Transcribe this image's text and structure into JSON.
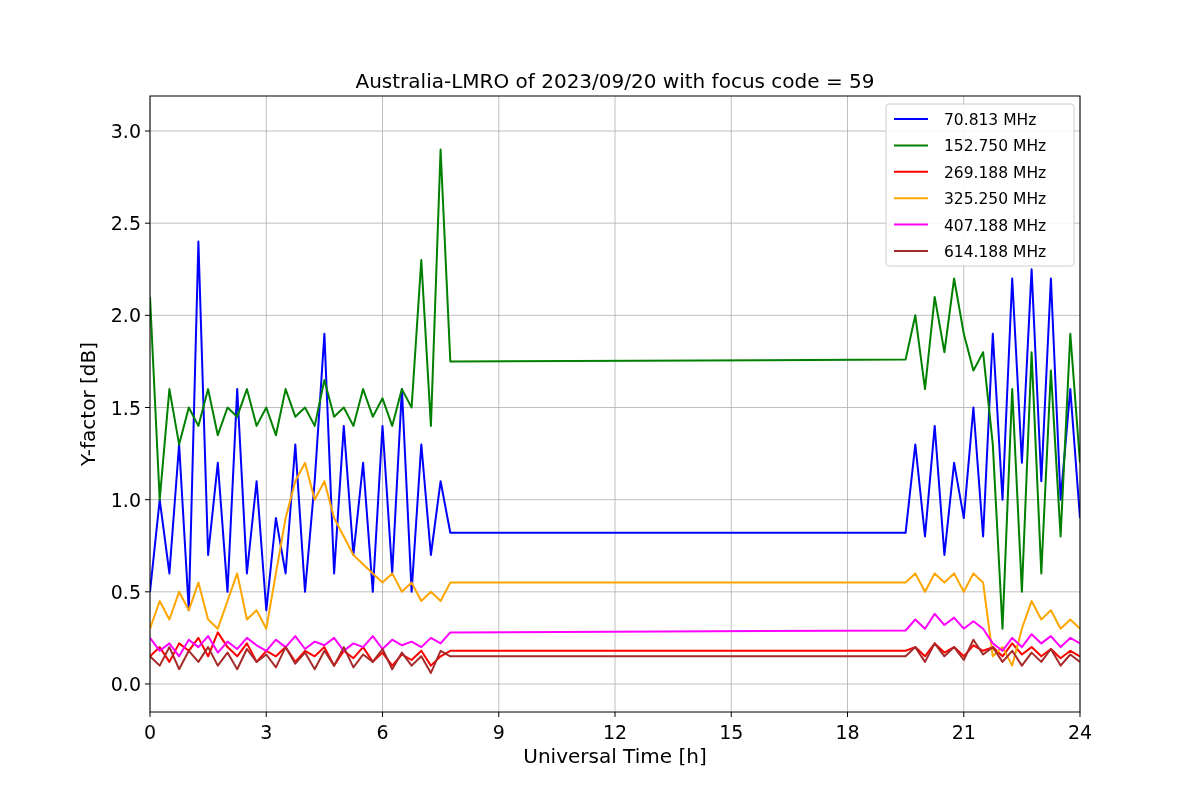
{
  "chart_data": {
    "type": "line",
    "title": "Australia-LMRO of 2023/09/20 with focus code = 59",
    "xlabel": "Universal Time [h]",
    "ylabel": "Y-factor [dB]",
    "x": [
      0,
      0.25,
      0.5,
      0.75,
      1,
      1.25,
      1.5,
      1.75,
      2,
      2.25,
      2.5,
      2.75,
      3,
      3.25,
      3.5,
      3.75,
      4,
      4.25,
      4.5,
      4.75,
      5,
      5.25,
      5.5,
      5.75,
      6,
      6.25,
      6.5,
      6.75,
      7,
      7.25,
      7.5,
      7.75,
      19.5,
      19.75,
      20,
      20.25,
      20.5,
      20.75,
      21,
      21.25,
      21.5,
      21.75,
      22,
      22.25,
      22.5,
      22.75,
      23,
      23.25,
      23.5,
      23.75,
      24
    ],
    "grid": true,
    "legend": true,
    "xlim": [
      0,
      24
    ],
    "ylim": [
      -0.152,
      3.19
    ],
    "xticks": [
      0,
      3,
      6,
      9,
      12,
      15,
      18,
      21,
      24
    ],
    "yticks": [
      {
        "value": 0,
        "label": "0.0"
      },
      {
        "value": 0.5,
        "label": "0.5"
      },
      {
        "value": 1,
        "label": "1.0"
      },
      {
        "value": 1.5,
        "label": "1.5"
      },
      {
        "value": 2,
        "label": "2.0"
      },
      {
        "value": 2.5,
        "label": "2.5"
      },
      {
        "value": 3,
        "label": "3.0"
      }
    ],
    "series": [
      {
        "name": "70.813 MHz",
        "color": "#0000ff",
        "values": [
          0.5,
          1.0,
          0.6,
          1.3,
          0.4,
          2.4,
          0.7,
          1.2,
          0.5,
          1.6,
          0.6,
          1.1,
          0.4,
          0.9,
          0.6,
          1.3,
          0.5,
          1.1,
          1.9,
          0.6,
          1.4,
          0.7,
          1.2,
          0.5,
          1.4,
          0.6,
          1.6,
          0.5,
          1.3,
          0.7,
          1.1,
          0.82,
          0.82,
          1.3,
          0.8,
          1.4,
          0.7,
          1.2,
          0.9,
          1.5,
          0.8,
          1.9,
          1.0,
          2.2,
          1.2,
          2.25,
          1.1,
          2.2,
          1.0,
          1.6,
          0.9
        ]
      },
      {
        "name": "152.750 MHz",
        "color": "#008000",
        "values": [
          2.1,
          1.0,
          1.6,
          1.3,
          1.5,
          1.4,
          1.6,
          1.35,
          1.5,
          1.45,
          1.6,
          1.4,
          1.5,
          1.35,
          1.6,
          1.45,
          1.5,
          1.4,
          1.65,
          1.45,
          1.5,
          1.4,
          1.6,
          1.45,
          1.55,
          1.4,
          1.6,
          1.5,
          2.3,
          1.4,
          2.9,
          1.75,
          1.76,
          2.0,
          1.6,
          2.1,
          1.8,
          2.2,
          1.9,
          1.7,
          1.8,
          1.3,
          0.3,
          1.6,
          0.5,
          1.8,
          0.6,
          1.7,
          0.8,
          1.9,
          1.2
        ]
      },
      {
        "name": "269.188 MHz",
        "color": "#ff0000",
        "values": [
          0.15,
          0.2,
          0.12,
          0.22,
          0.18,
          0.25,
          0.15,
          0.28,
          0.2,
          0.15,
          0.22,
          0.12,
          0.18,
          0.15,
          0.2,
          0.12,
          0.18,
          0.15,
          0.2,
          0.1,
          0.18,
          0.14,
          0.2,
          0.12,
          0.17,
          0.1,
          0.16,
          0.13,
          0.18,
          0.1,
          0.15,
          0.18,
          0.18,
          0.2,
          0.15,
          0.22,
          0.17,
          0.2,
          0.15,
          0.21,
          0.18,
          0.2,
          0.15,
          0.22,
          0.16,
          0.2,
          0.15,
          0.19,
          0.14,
          0.18,
          0.15
        ]
      },
      {
        "name": "325.250 MHz",
        "color": "#ffa500",
        "values": [
          0.3,
          0.45,
          0.35,
          0.5,
          0.4,
          0.55,
          0.35,
          0.3,
          0.45,
          0.6,
          0.35,
          0.4,
          0.3,
          0.6,
          0.9,
          1.1,
          1.2,
          1.0,
          1.1,
          0.9,
          0.8,
          0.7,
          0.65,
          0.6,
          0.55,
          0.6,
          0.5,
          0.55,
          0.45,
          0.5,
          0.45,
          0.55,
          0.55,
          0.6,
          0.5,
          0.6,
          0.55,
          0.6,
          0.5,
          0.6,
          0.55,
          0.15,
          0.2,
          0.1,
          0.3,
          0.45,
          0.35,
          0.4,
          0.3,
          0.35,
          0.3
        ]
      },
      {
        "name": "407.188 MHz",
        "color": "#ff00ff",
        "values": [
          0.25,
          0.18,
          0.22,
          0.15,
          0.24,
          0.2,
          0.26,
          0.17,
          0.23,
          0.19,
          0.25,
          0.21,
          0.18,
          0.24,
          0.2,
          0.26,
          0.19,
          0.23,
          0.21,
          0.25,
          0.18,
          0.22,
          0.2,
          0.26,
          0.19,
          0.24,
          0.21,
          0.23,
          0.2,
          0.25,
          0.22,
          0.28,
          0.29,
          0.35,
          0.3,
          0.38,
          0.32,
          0.36,
          0.3,
          0.34,
          0.3,
          0.22,
          0.18,
          0.25,
          0.2,
          0.27,
          0.22,
          0.26,
          0.2,
          0.25,
          0.22
        ]
      },
      {
        "name": "614.188 MHz",
        "color": "#a52a2a",
        "values": [
          0.15,
          0.1,
          0.2,
          0.08,
          0.18,
          0.12,
          0.2,
          0.1,
          0.17,
          0.08,
          0.19,
          0.12,
          0.16,
          0.09,
          0.2,
          0.11,
          0.17,
          0.08,
          0.18,
          0.1,
          0.2,
          0.09,
          0.16,
          0.12,
          0.19,
          0.08,
          0.17,
          0.1,
          0.15,
          0.06,
          0.18,
          0.15,
          0.15,
          0.2,
          0.12,
          0.22,
          0.15,
          0.2,
          0.13,
          0.24,
          0.16,
          0.2,
          0.12,
          0.18,
          0.1,
          0.17,
          0.12,
          0.19,
          0.1,
          0.16,
          0.12
        ]
      }
    ]
  }
}
